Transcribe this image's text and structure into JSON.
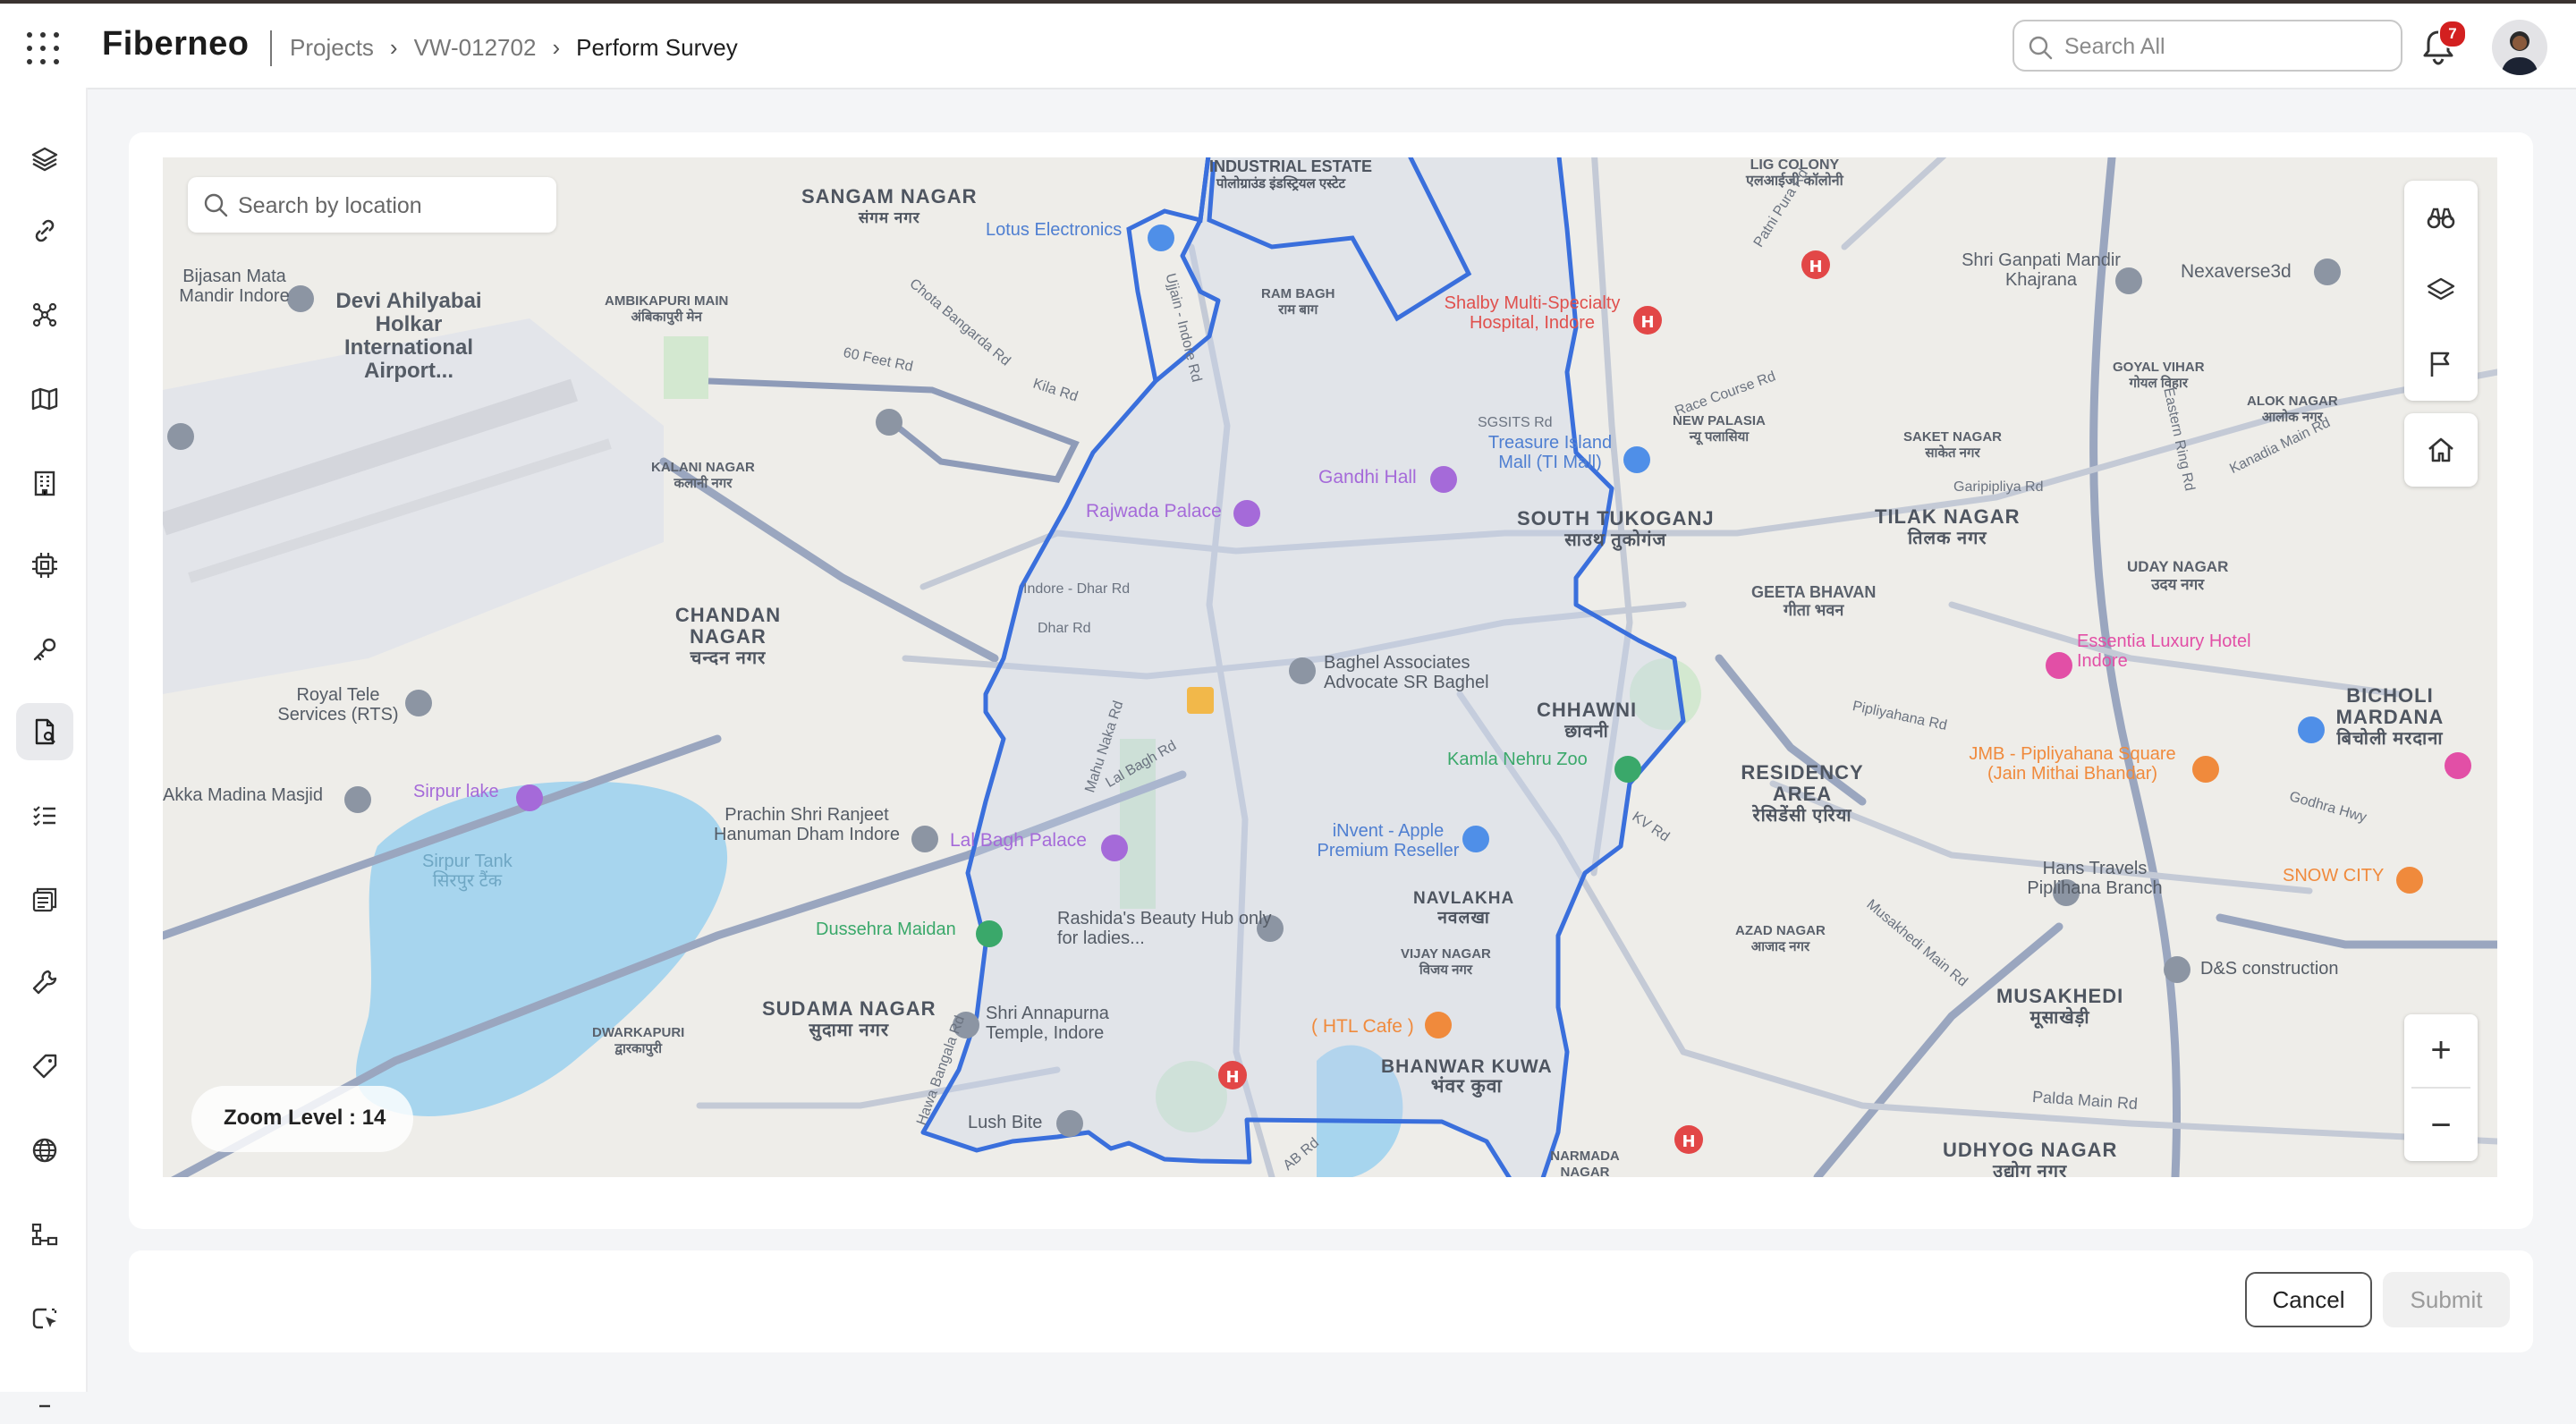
{
  "header": {
    "app_name": "Fiberneo",
    "breadcrumbs": [
      "Projects",
      "VW-012702",
      "Perform Survey"
    ],
    "search_placeholder": "Search All",
    "notification_count": "7"
  },
  "sidebar": {
    "items": [
      {
        "icon": "layers-icon",
        "active": false
      },
      {
        "icon": "link-icon",
        "active": false
      },
      {
        "icon": "network-icon",
        "active": false
      },
      {
        "icon": "map-icon",
        "active": false
      },
      {
        "icon": "building-icon",
        "active": false
      },
      {
        "icon": "chip-icon",
        "active": false
      },
      {
        "icon": "key-icon",
        "active": false
      },
      {
        "icon": "survey-document-icon",
        "active": true
      },
      {
        "icon": "task-list-icon",
        "active": false
      },
      {
        "icon": "inventory-icon",
        "active": false
      },
      {
        "icon": "wrench-icon",
        "active": false
      },
      {
        "icon": "tag-icon",
        "active": false
      },
      {
        "icon": "globe-icon",
        "active": false
      },
      {
        "icon": "hierarchy-icon",
        "active": false
      },
      {
        "icon": "pointer-icon",
        "active": false
      }
    ]
  },
  "map": {
    "search_placeholder": "Search by location",
    "zoom_level_text": "Zoom Level : 14",
    "zoom_in": "+",
    "zoom_out": "−",
    "labels": [
      {
        "text": "SANGAM NAGAR",
        "sub": "संगम नगर"
      },
      {
        "text": "INDUSTRIAL ESTATE",
        "sub": "पोलोग्राउंड इंडस्ट्रियल एस्टेट"
      },
      {
        "text": "LIG COLONY",
        "sub": "एलआईजी कॉलोनी"
      },
      {
        "text": "Lotus Electronics"
      },
      {
        "text": "Devi Ahilyabai Holkar International Airport..."
      },
      {
        "text": "Bijasan Mata Mandir Indore"
      },
      {
        "text": "AMBIKAPURI MAIN",
        "sub": "अंबिकापुरी मेन"
      },
      {
        "text": "Shri Ganpati Mandir Khajrana"
      },
      {
        "text": "Nexaverse3d"
      },
      {
        "text": "Shalby Multi-Specialty Hospital, Indore"
      },
      {
        "text": "GOYAL VIHAR",
        "sub": "गोयल विहार"
      },
      {
        "text": "ALOK NAGAR",
        "sub": "आलोक नगर"
      },
      {
        "text": "NEW PALASIA",
        "sub": "न्यू पलासिया"
      },
      {
        "text": "Treasure Island Mall (TI Mall)"
      },
      {
        "text": "SAKET NAGAR",
        "sub": "साकेत नगर"
      },
      {
        "text": "KALANI NAGAR",
        "sub": "कलानी नगर"
      },
      {
        "text": "Gandhi Hall"
      },
      {
        "text": "Rajwada Palace"
      },
      {
        "text": "SOUTH TUKOGANJ",
        "sub": "साउथ तुकोगंज"
      },
      {
        "text": "TILAK NAGAR",
        "sub": "तिलक नगर"
      },
      {
        "text": "UDAY NAGAR",
        "sub": "उदय नगर"
      },
      {
        "text": "CHANDAN NAGAR",
        "sub": "चन्दन नगर"
      },
      {
        "text": "GEETA BHAVAN",
        "sub": "गीता भवन"
      },
      {
        "text": "Essentia Luxury Hotel Indore"
      },
      {
        "text": "Royal Tele Services (RTS)"
      },
      {
        "text": "Baghel Associates Advocate SR Baghel"
      },
      {
        "text": "CHHAWNI",
        "sub": "छावनी"
      },
      {
        "text": "BICHOLI MARDANA",
        "sub": "बिचोली मरदाना"
      },
      {
        "text": "Kamla Nehru Zoo"
      },
      {
        "text": "RESIDENCY AREA",
        "sub": "रेसिडेंसी एरिया"
      },
      {
        "text": "JMB - Pipliyahana Square (Jain Mithai Bhandar)"
      },
      {
        "text": "Sirpur lake"
      },
      {
        "text": "Akka Madina Masjid"
      },
      {
        "text": "Prachin Shri Ranjeet Hanuman Dham Indore"
      },
      {
        "text": "Lal Bagh Palace"
      },
      {
        "text": "iNvent - Apple Premium Reseller"
      },
      {
        "text": "Sirpur Tank",
        "sub": "सिरपुर टैंक"
      },
      {
        "text": "NAVLAKHA",
        "sub": "नवलखा"
      },
      {
        "text": "Hans Travels Piplihana Branch"
      },
      {
        "text": "SNOW CITY"
      },
      {
        "text": "Rashida's Beauty Hub only for ladies..."
      },
      {
        "text": "Dussehra Maidan"
      },
      {
        "text": "VIJAY NAGAR",
        "sub": "विजय नगर"
      },
      {
        "text": "AZAD NAGAR",
        "sub": "आजाद नगर"
      },
      {
        "text": "D&S construction"
      },
      {
        "text": "SUDAMA NAGAR",
        "sub": "सुदामा नगर"
      },
      {
        "text": "Shri Annapurna Temple, Indore"
      },
      {
        "text": "( HTL Cafe )"
      },
      {
        "text": "MUSAKHEDI",
        "sub": "मूसाखेड़ी"
      },
      {
        "text": "DWARKAPURI",
        "sub": "द्वारकापुरी"
      },
      {
        "text": "BHANWAR KUWA",
        "sub": "भंवर कुवा"
      },
      {
        "text": "Lush Bite"
      },
      {
        "text": "UDHYOG NAGAR",
        "sub": "उद्योग नगर"
      },
      {
        "text": "NARMADA NAGAR"
      },
      {
        "text": "Palda Main Rd"
      },
      {
        "text": "Indore - Dhar Rd"
      },
      {
        "text": "Dhar Rd"
      },
      {
        "text": "Kila Rd"
      },
      {
        "text": "Pipliyahana Rd"
      },
      {
        "text": "Godhra Hwy"
      },
      {
        "text": "Race Course Rd"
      },
      {
        "text": "Patni Pura Rd"
      },
      {
        "text": "Kanadia Main Rd"
      },
      {
        "text": "Eastern Ring Rd"
      },
      {
        "text": "60 Feet Rd"
      },
      {
        "text": "Chota Bangarda Rd"
      },
      {
        "text": "Ujjain - Indore Rd"
      },
      {
        "text": "Lal Bagh Rd"
      },
      {
        "text": "Mahu Naka Rd"
      },
      {
        "text": "AB Rd"
      },
      {
        "text": "KV Rd"
      },
      {
        "text": "Hawa Bangala Rd"
      },
      {
        "text": "RAM BAGH",
        "sub": "राम बाग"
      },
      {
        "text": "SGSITS Rd"
      },
      {
        "text": "Garipipliya Rd"
      },
      {
        "text": "Musakhedi Main Rd"
      }
    ]
  },
  "footer": {
    "cancel_label": "Cancel",
    "submit_label": "Submit"
  }
}
